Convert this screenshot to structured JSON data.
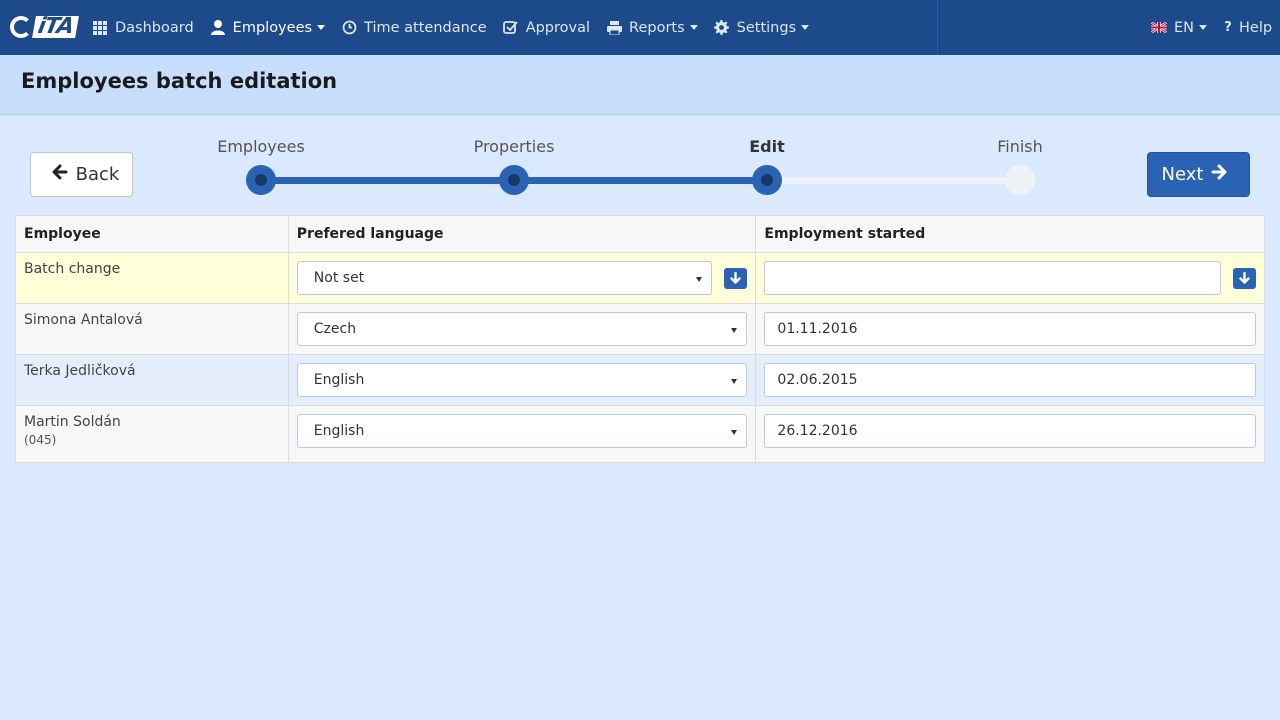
{
  "brand": {
    "logo_text": "iTA"
  },
  "nav": {
    "items": [
      {
        "label": "Dashboard",
        "icon": "grid-icon"
      },
      {
        "label": "Employees",
        "icon": "user-icon"
      },
      {
        "label": "Time attendance",
        "icon": "clock-icon"
      },
      {
        "label": "Approval",
        "icon": "check-icon"
      },
      {
        "label": "Reports",
        "icon": "printer-icon"
      },
      {
        "label": "Settings",
        "icon": "gear-icon"
      }
    ],
    "language": "EN",
    "help": "Help"
  },
  "page": {
    "title": "Employees batch editation"
  },
  "wizard": {
    "back_label": "Back",
    "next_label": "Next",
    "steps": [
      "Employees",
      "Properties",
      "Edit",
      "Finish"
    ],
    "current_step": "Edit"
  },
  "table": {
    "headers": [
      "Employee",
      "Prefered language",
      "Employment started"
    ],
    "batch": {
      "label": "Batch change",
      "language": "Not set",
      "started": ""
    },
    "rows": [
      {
        "name": "Simona Antalová",
        "code": "",
        "language": "Czech",
        "started": "01.11.2016"
      },
      {
        "name": "Terka Jedličková",
        "code": "",
        "language": "English",
        "started": "02.06.2015"
      },
      {
        "name": "Martin Soldán",
        "code": "(045)",
        "language": "English",
        "started": "26.12.2016"
      }
    ]
  },
  "colors": {
    "navbar": "#1c4a8a",
    "accent": "#2a63b3",
    "background": "#dae9fd",
    "header": "#c7defd",
    "batch_row": "#fefed8"
  }
}
